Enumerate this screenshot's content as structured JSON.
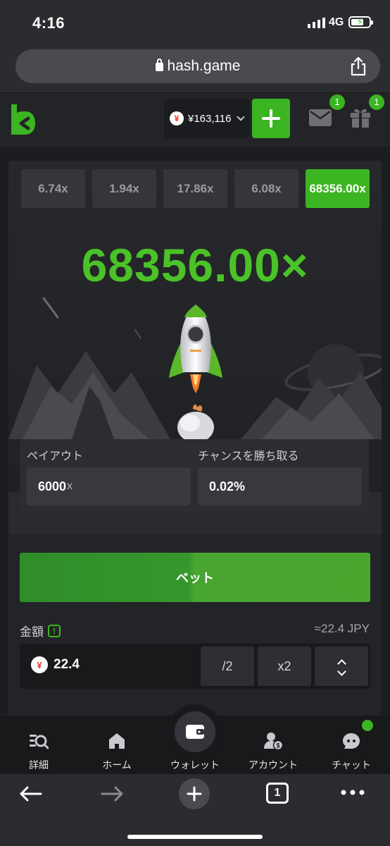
{
  "status_bar": {
    "time": "4:16",
    "network": "4G"
  },
  "browser": {
    "url": "hash.game"
  },
  "header": {
    "balance": "¥163,116",
    "currency_symbol": "¥",
    "mail_badge": "1",
    "gift_badge": "1"
  },
  "game": {
    "history": [
      "6.74x",
      "1.94x",
      "17.86x",
      "6.08x",
      "68356.00x"
    ],
    "multiplier": "68356.00×",
    "payout_label": "ペイアウト",
    "payout_value": "6000",
    "payout_suffix": "x",
    "chance_label": "チャンスを勝ち取る",
    "chance_value": "0.02%"
  },
  "bet": {
    "button_label": "ベット",
    "amount_label": "金額",
    "amount_info_icon": "!",
    "amount_approx": "≈22.4 JPY",
    "amount_value": "22.4",
    "half_label": "/2",
    "double_label": "x2"
  },
  "bottom_nav": {
    "items": [
      {
        "label": "詳細",
        "icon": "search-list-icon"
      },
      {
        "label": "ホーム",
        "icon": "home-icon"
      },
      {
        "label": "ウォレット",
        "icon": "wallet-icon"
      },
      {
        "label": "アカウント",
        "icon": "account-icon"
      },
      {
        "label": "チャット",
        "icon": "chat-icon"
      }
    ]
  },
  "safari_toolbar": {
    "tabs_count": "1"
  },
  "colors": {
    "accent": "#3cb522",
    "multiplier": "#4ac228",
    "background": "#1c1d20"
  }
}
